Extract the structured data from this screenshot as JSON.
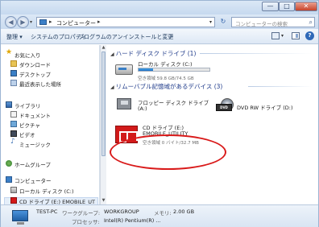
{
  "window": {
    "controls": {
      "minimize": "—",
      "maximize": "□",
      "close": "✕"
    }
  },
  "address_bar": {
    "back_icon": "back-arrow-icon",
    "forward_icon": "forward-arrow-icon",
    "path_separator": "▸",
    "path": "コンピューター",
    "refresh_glyph": "↻",
    "search_placeholder": "コンピューターの検索",
    "search_glyph": "⌕"
  },
  "command_bar": {
    "organize": "整理 ▾",
    "system_properties": "システムのプロパティ",
    "uninstall": "プログラムのアンインストールと変更",
    "more": "»"
  },
  "nav_pane": {
    "favorites": {
      "label": "お気に入り",
      "items": [
        "ダウンロード",
        "デスクトップ",
        "最近表示した場所"
      ]
    },
    "libraries": {
      "label": "ライブラリ",
      "items": [
        "ドキュメント",
        "ピクチャ",
        "ビデオ",
        "ミュージック"
      ]
    },
    "homegroup": "ホームグループ",
    "computer": {
      "label": "コンピューター",
      "items": [
        "ローカル ディスク (C:)",
        "CD ドライブ (E:) EMOBILE_UT"
      ]
    }
  },
  "content": {
    "hdd_group": "ハード ディスク ドライブ (1)",
    "local_disk": {
      "name": "ローカル ディスク (C:)",
      "info": "空き領域 59.8 GB/74.5 GB",
      "used_fraction": 0.2
    },
    "removable_group": "リムーバブル記憶域があるデバイス (3)",
    "floppy": {
      "name": "フロッピー ディスク ドライブ",
      "sub": "(A:)"
    },
    "dvd": {
      "name": "DVD RW ドライブ (D:)",
      "badge": "DVD"
    },
    "cd": {
      "name": "CD ドライブ (E:)",
      "label": "EMOBILE_UTILITY",
      "info": "空き領域 0 バイト/32.7 MB"
    }
  },
  "details": {
    "pc_name": "TEST-PC",
    "workgroup_key": "ワークグループ:",
    "workgroup": "WORKGROUP",
    "memory_key": "メモリ:",
    "memory": "2.00 GB",
    "processor_key": "プロセッサ:",
    "processor": "Intel(R) Pentium(R) ..."
  },
  "colors": {
    "highlight_ellipse": "#d91a1a",
    "emobile_red": "#d21a1a"
  }
}
